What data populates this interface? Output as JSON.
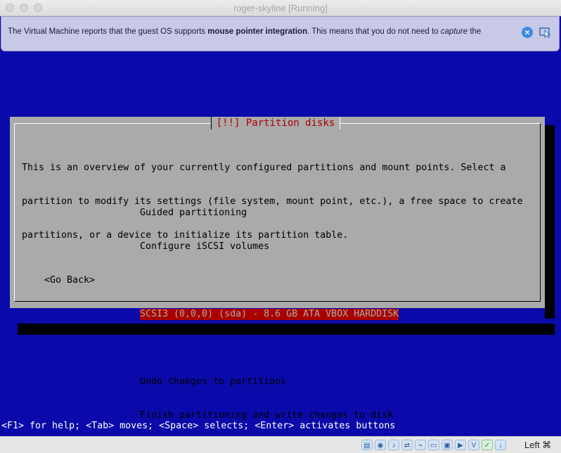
{
  "window": {
    "title": "roger-skyline [Running]"
  },
  "banner": {
    "text_1": "The Virtual Machine reports that the guest OS supports ",
    "text_bold": "mouse pointer integration",
    "text_2": ". This means that you do not need to ",
    "text_italic": "capture",
    "text_3": " the",
    "close_icon": "close-icon",
    "pointer_icon": "mouse-pointer-icon"
  },
  "dialog": {
    "title": "[!!] Partition disks",
    "description": [
      "This is an overview of your currently configured partitions and mount points. Select a",
      "partition to modify its settings (file system, mount point, etc.), a free space to create",
      "partitions, or a device to initialize its partition table."
    ],
    "menu": [
      "Guided partitioning",
      "Configure iSCSI volumes",
      "",
      "SCSI3 (0,0,0) (sda) - 8.6 GB ATA VBOX HARDDISK",
      "",
      "Undo changes to partitions",
      "Finish partitioning and write changes to disk"
    ],
    "selected_index": 3,
    "go_back": "<Go Back>"
  },
  "help_line": "<F1> for help; <Tab> moves; <Space> selects; <Enter> activates buttons",
  "statusbar": {
    "icons": [
      "hard-disk-icon",
      "optical-disk-icon",
      "audio-icon",
      "network-icon",
      "usb-icon",
      "shared-folders-icon",
      "display-icon",
      "video-capture-icon",
      "virtualization-icon",
      "mouse-integration-icon",
      "download-icon"
    ],
    "host_key": "Left ⌘"
  },
  "colors": {
    "screen_blue": "#0a0aaa",
    "dialog_gray": "#aaaaaa",
    "title_red": "#aa0000",
    "selection_red": "#aa0000"
  }
}
